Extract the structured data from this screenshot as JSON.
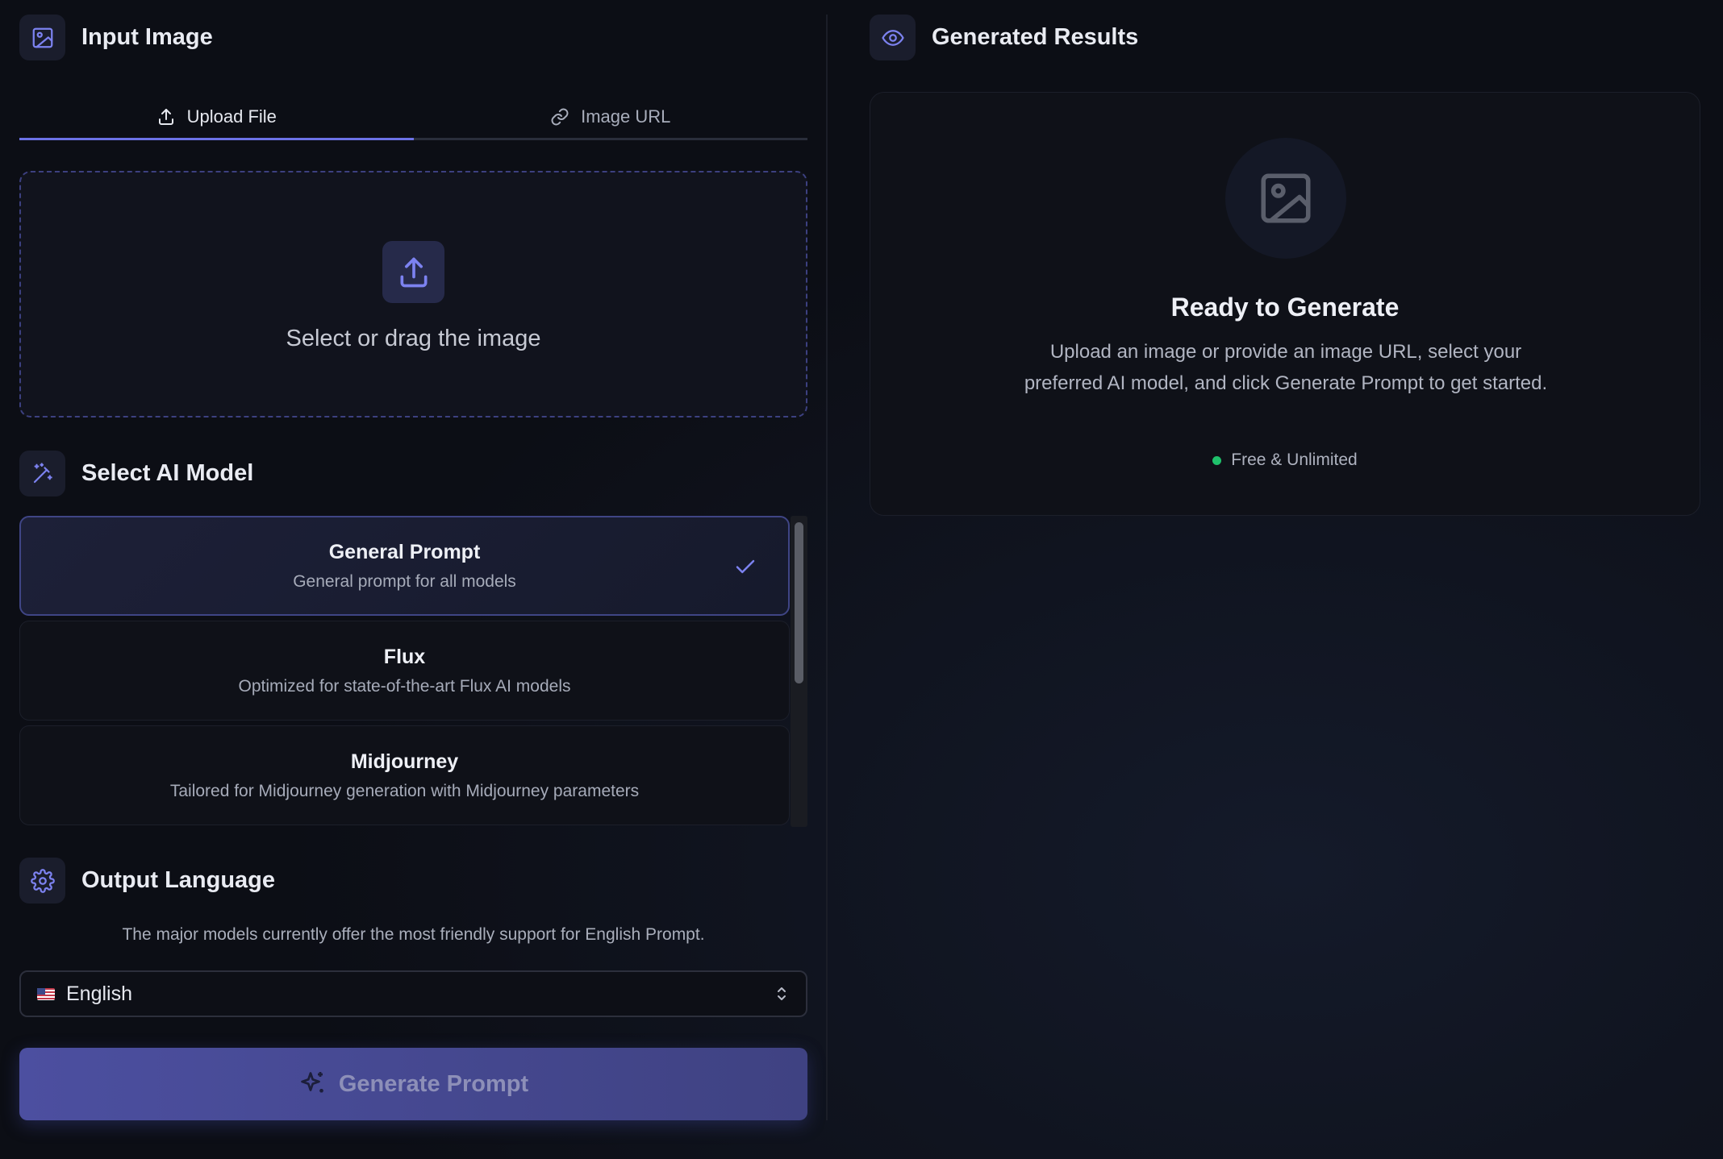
{
  "input_section": {
    "title": "Input Image",
    "tabs": [
      {
        "label": "Upload File",
        "active": true
      },
      {
        "label": "Image URL",
        "active": false
      }
    ],
    "dropzone_text": "Select or drag the image"
  },
  "model_section": {
    "title": "Select AI Model",
    "models": [
      {
        "name": "General Prompt",
        "description": "General prompt for all models",
        "selected": true
      },
      {
        "name": "Flux",
        "description": "Optimized for state-of-the-art Flux AI models",
        "selected": false
      },
      {
        "name": "Midjourney",
        "description": "Tailored for Midjourney generation with Midjourney parameters",
        "selected": false
      }
    ]
  },
  "language_section": {
    "title": "Output Language",
    "note": "The major models currently offer the most friendly support for English Prompt.",
    "selected_language": "English",
    "flag_icon": "us-flag-icon"
  },
  "generate_button": {
    "label": "Generate Prompt",
    "icon": "sparkles-icon"
  },
  "results_section": {
    "title": "Generated Results",
    "ready_title": "Ready to Generate",
    "ready_description": "Upload an image or provide an image URL, select your preferred AI model, and click Generate Prompt to get started.",
    "badge_label": "Free & Unlimited",
    "badge_color": "#1fc16b"
  },
  "colors": {
    "accent": "#6c72e6",
    "background": "#0c0e15",
    "button": "#4c4fa0"
  }
}
